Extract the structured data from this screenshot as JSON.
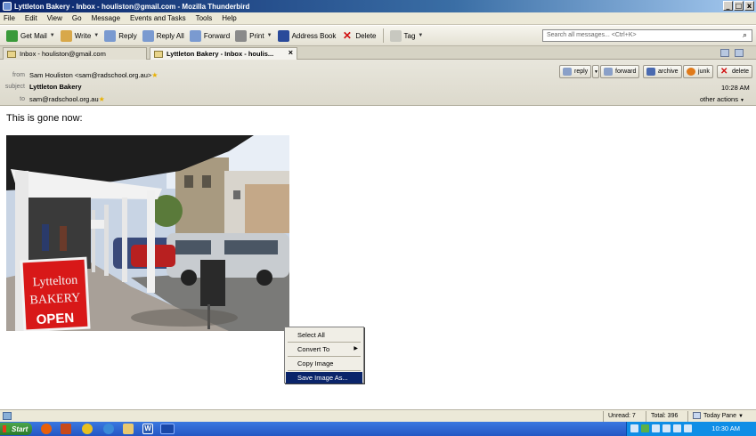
{
  "window": {
    "title": "Lyttleton Bakery - Inbox - houliston@gmail.com - Mozilla Thunderbird",
    "controls": [
      "_",
      "□",
      "x"
    ]
  },
  "menu": [
    "File",
    "Edit",
    "View",
    "Go",
    "Message",
    "Events and Tasks",
    "Tools",
    "Help"
  ],
  "toolbar": {
    "buttons": [
      {
        "label": "Get Mail",
        "icon": "get-mail-icon",
        "dropdown": true
      },
      {
        "label": "Write",
        "icon": "write-icon",
        "dropdown": true
      },
      {
        "label": "Reply",
        "icon": "reply-icon"
      },
      {
        "label": "Reply All",
        "icon": "reply-all-icon"
      },
      {
        "label": "Forward",
        "icon": "forward-icon"
      },
      {
        "label": "Print",
        "icon": "print-icon",
        "dropdown": true
      },
      {
        "label": "Address Book",
        "icon": "address-book-icon"
      },
      {
        "label": "Delete",
        "icon": "delete-icon"
      },
      {
        "label": "Tag",
        "icon": "tag-icon",
        "dropdown": true
      }
    ],
    "search_placeholder": "Search all messages... <Ctrl+K>"
  },
  "tabs": [
    {
      "label": "Inbox - houliston@gmail.com",
      "active": false
    },
    {
      "label": "Lyttleton Bakery - Inbox - houlis...",
      "active": true
    }
  ],
  "header": {
    "from_label": "from",
    "from_value": "Sam Houliston <sam@radschool.org.au>",
    "subject_label": "subject",
    "subject_value": "Lyttleton Bakery",
    "to_label": "to",
    "to_value": "sam@radschool.org.au",
    "time": "10:28 AM",
    "other_actions": "other actions",
    "buttons": [
      {
        "label": "reply",
        "icon": "reply-icon"
      },
      {
        "label": "forward",
        "icon": "forward-icon"
      },
      {
        "label": "archive",
        "icon": "archive-icon"
      },
      {
        "label": "junk",
        "icon": "junk-icon"
      },
      {
        "label": "delete",
        "icon": "delete-icon"
      }
    ]
  },
  "message": {
    "body_text": "This is gone now:",
    "photo_sign_line1": "Lyttelton",
    "photo_sign_line2": "BAKERY",
    "photo_sign_line3": "OPEN"
  },
  "context_menu": {
    "items": [
      {
        "label": "Select All",
        "submenu": false,
        "highlighted": false
      },
      {
        "label": "Convert To",
        "submenu": true,
        "highlighted": false
      },
      {
        "label": "Copy Image",
        "submenu": false,
        "highlighted": false
      },
      {
        "label": "Save Image As...",
        "submenu": false,
        "highlighted": true
      }
    ]
  },
  "status": {
    "unread": "Unread: 7",
    "total": "Total: 396",
    "today_pane": "Today Pane"
  },
  "taskbar": {
    "start_label": "Start",
    "clock": "10:30 AM"
  },
  "colors": {
    "titlebar": "#0a246a",
    "selection": "#0a246a",
    "taskbar": "#2456c4",
    "start": "#2a7a2a"
  }
}
